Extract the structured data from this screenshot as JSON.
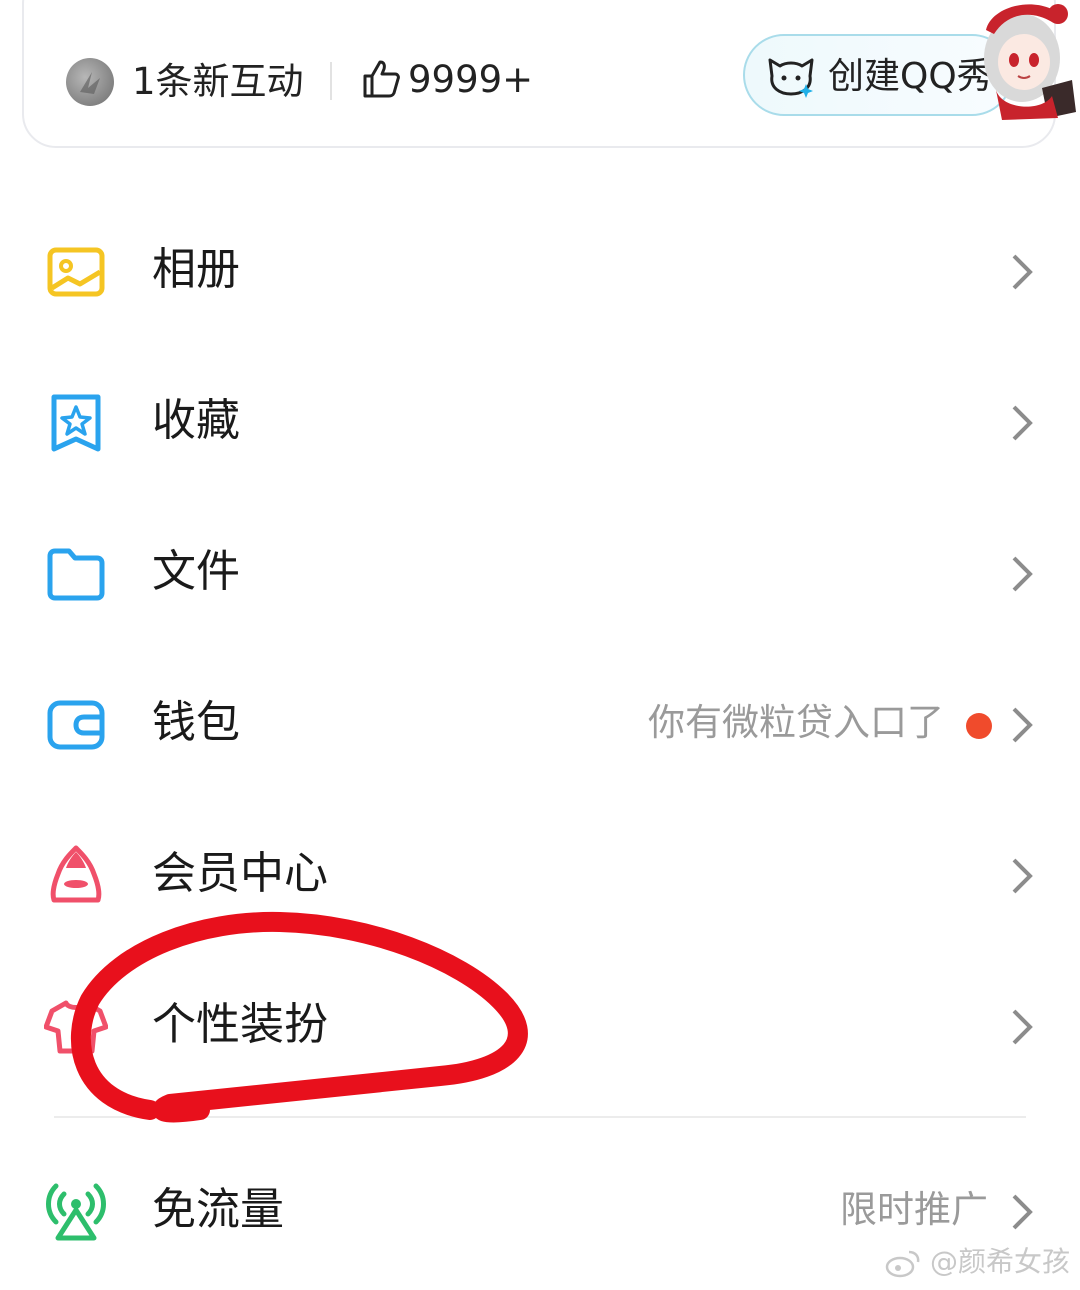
{
  "profile_card": {
    "interactions_text": "1条新互动",
    "likes_count": "9999+",
    "qq_show_button": "创建QQ秀"
  },
  "menu": {
    "items": [
      {
        "label": "相册",
        "icon": "photo-album-icon",
        "color": "#F5C523"
      },
      {
        "label": "收藏",
        "icon": "favorites-star-icon",
        "color": "#2AA3EE"
      },
      {
        "label": "文件",
        "icon": "folder-icon",
        "color": "#2AA3EE"
      },
      {
        "label": "钱包",
        "icon": "wallet-icon",
        "color": "#2AA3EE",
        "hint": "你有微粒贷入口了",
        "badge": true
      },
      {
        "label": "会员中心",
        "icon": "membership-icon",
        "color": "#F0506A"
      },
      {
        "label": "个性装扮",
        "icon": "tshirt-icon",
        "color": "#F0506A"
      },
      {
        "label": "免流量",
        "icon": "signal-tower-icon",
        "color": "#2DBE6C",
        "hint": "限时推广"
      }
    ]
  },
  "annotation": {
    "color": "#E8101C"
  },
  "watermark": {
    "text": "@颜希女孩"
  }
}
